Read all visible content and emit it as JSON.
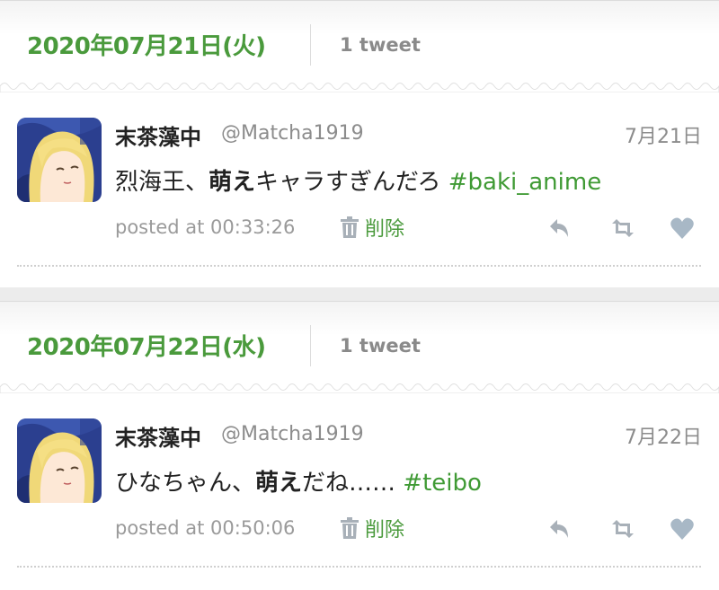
{
  "days": [
    {
      "date": "2020年07月21日(火)",
      "count": "1 tweet",
      "tweet": {
        "name": "末茶藻中",
        "handle": "@Matcha1919",
        "date": "7月21日",
        "text_before": "烈海王、",
        "text_bold": "萌え",
        "text_after": "キャラすぎんだろ ",
        "hashtag": "#baki_anime",
        "posted": "posted at 00:33:26",
        "delete_label": "削除"
      }
    },
    {
      "date": "2020年07月22日(水)",
      "count": "1 tweet",
      "tweet": {
        "name": "末茶藻中",
        "handle": "@Matcha1919",
        "date": "7月22日",
        "text_before": "ひなちゃん、",
        "text_bold": "萌え",
        "text_after": "だね…… ",
        "hashtag": "#teibo",
        "posted": "posted at 00:50:06",
        "delete_label": "削除"
      }
    }
  ],
  "icons": {
    "reply": "reply-icon",
    "retweet": "retweet-icon",
    "like": "heart-icon",
    "delete": "trash-icon"
  },
  "colors": {
    "accent_green": "#4a9a3c",
    "hashtag_green": "#3f9a34",
    "muted_gray": "#8c8c8c",
    "icon_gray": "#a8b0b8"
  }
}
